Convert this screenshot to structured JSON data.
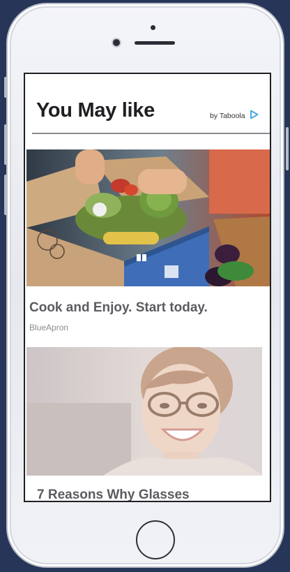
{
  "widget": {
    "title": "You May like",
    "provider_label": "by Taboola",
    "provider_icon": "taboola-play-icon",
    "accent_color": "#4aa9e0"
  },
  "cards": [
    {
      "title": "Cook and Enjoy. Start today.",
      "source": "BlueApron",
      "image_icon": "meal-kit-box-photo"
    },
    {
      "title": "7 Reasons Why Glasses",
      "source": "",
      "image_icon": "smiling-woman-glasses-photo"
    }
  ],
  "device": {
    "home_button_icon": "home-button-icon"
  }
}
